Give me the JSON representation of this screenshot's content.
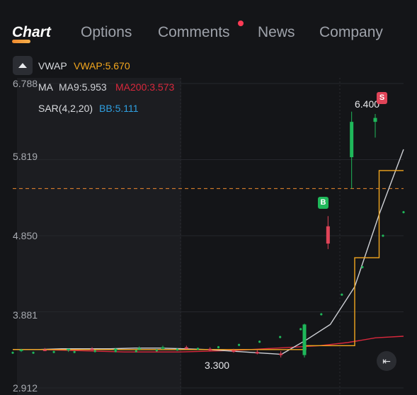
{
  "tabs": {
    "chart": "Chart",
    "options": "Options",
    "comments": "Comments",
    "news": "News",
    "company": "Company"
  },
  "indicators": {
    "vwap_name": "VWAP",
    "vwap_value": "VWAP:5.670",
    "ma_name": "MA",
    "ma9": "MA9:5.953",
    "ma200": "MA200:3.573",
    "sar_name": "SAR(4,2,20)",
    "bb": "BB:5.111"
  },
  "y_axis": {
    "labels": [
      "6.788",
      "5.819",
      "4.850",
      "3.881",
      "2.912"
    ]
  },
  "annotations": {
    "high_label": "6.400",
    "low_label": "3.300",
    "buy_badge": "B",
    "sell_badge": "S"
  },
  "colors": {
    "vwap": "#f3a71e",
    "ma9": "#cfd1d6",
    "ma200": "#d9283c",
    "bb": "#2f9fe0",
    "up": "#1fb85a",
    "down": "#e04458",
    "accent": "#f08a2e"
  },
  "icons": {
    "toggle": "caret-up-icon",
    "back": "return-arrow-icon"
  },
  "chart_data": {
    "type": "candlestick",
    "y_range": [
      2.912,
      6.788
    ],
    "y_ticks": [
      6.788,
      5.819,
      4.85,
      3.881,
      2.912
    ],
    "reference_line": 5.45,
    "candles": [
      {
        "o": 3.39,
        "h": 3.41,
        "l": 3.37,
        "c": 3.4
      },
      {
        "o": 3.4,
        "h": 3.42,
        "l": 3.38,
        "c": 3.39
      },
      {
        "o": 3.39,
        "h": 3.41,
        "l": 3.37,
        "c": 3.41
      },
      {
        "o": 3.41,
        "h": 3.43,
        "l": 3.39,
        "c": 3.4
      },
      {
        "o": 3.4,
        "h": 3.42,
        "l": 3.38,
        "c": 3.41
      },
      {
        "o": 3.41,
        "h": 3.44,
        "l": 3.39,
        "c": 3.42
      },
      {
        "o": 3.42,
        "h": 3.45,
        "l": 3.4,
        "c": 3.43
      },
      {
        "o": 3.43,
        "h": 3.45,
        "l": 3.41,
        "c": 3.41
      },
      {
        "o": 3.41,
        "h": 3.43,
        "l": 3.38,
        "c": 3.39
      },
      {
        "o": 3.39,
        "h": 3.41,
        "l": 3.36,
        "c": 3.37
      },
      {
        "o": 3.37,
        "h": 3.4,
        "l": 3.34,
        "c": 3.35
      },
      {
        "o": 3.35,
        "h": 3.38,
        "l": 3.3,
        "c": 3.33
      },
      {
        "o": 3.33,
        "h": 3.73,
        "l": 3.3,
        "c": 3.72
      },
      {
        "o": 4.97,
        "h": 5.1,
        "l": 4.68,
        "c": 4.75
      },
      {
        "o": 5.85,
        "h": 6.43,
        "l": 5.45,
        "c": 6.3
      },
      {
        "o": 6.3,
        "h": 6.4,
        "l": 6.1,
        "c": 6.35
      }
    ],
    "vwap": [
      3.4,
      3.4,
      3.4,
      3.4,
      3.4,
      3.4,
      3.4,
      3.4,
      3.4,
      3.4,
      3.4,
      3.4,
      3.45,
      3.45,
      4.57,
      5.68,
      5.68
    ],
    "ma9": [
      3.4,
      3.4,
      3.41,
      3.41,
      3.41,
      3.42,
      3.42,
      3.41,
      3.4,
      3.38,
      3.36,
      3.34,
      3.52,
      3.72,
      4.2,
      5.12,
      5.95
    ],
    "ma200": [
      3.4,
      3.4,
      3.39,
      3.38,
      3.37,
      3.37,
      3.37,
      3.38,
      3.39,
      3.41,
      3.43,
      3.45,
      3.49,
      3.55,
      3.57
    ],
    "sar": [
      3.36,
      3.36,
      3.37,
      3.37,
      3.38,
      3.38,
      3.38,
      3.39,
      3.4,
      3.41,
      3.43,
      3.46,
      3.5,
      3.56,
      3.66,
      3.85,
      4.1,
      4.45,
      4.85,
      5.15
    ]
  }
}
